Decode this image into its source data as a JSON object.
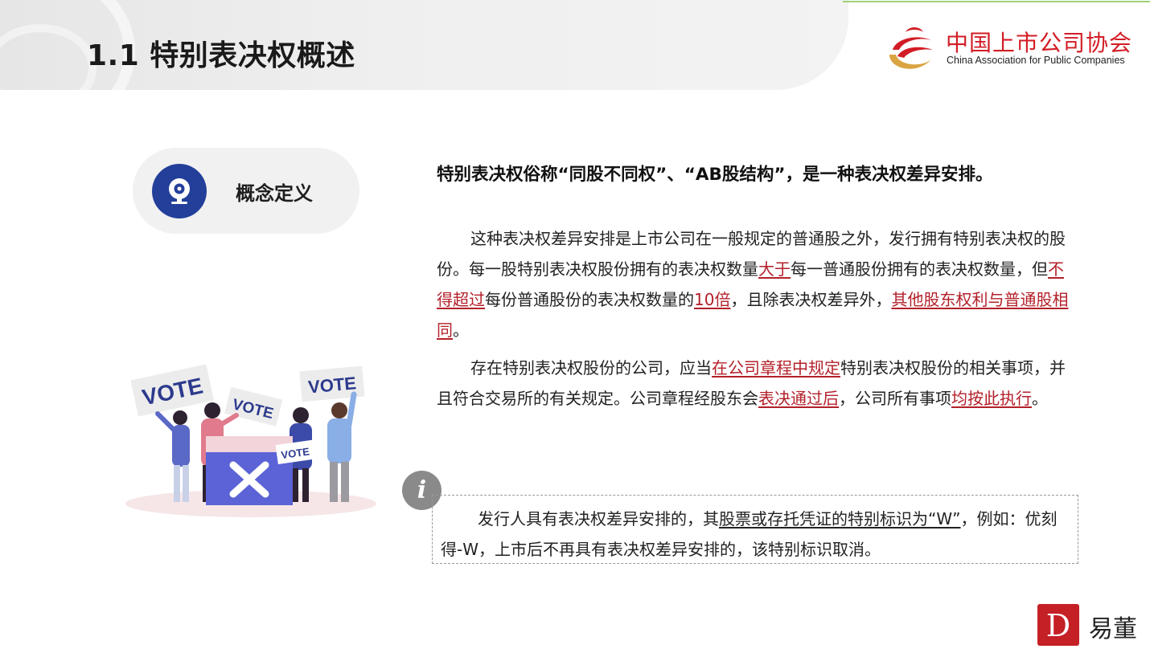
{
  "header": {
    "title": "1.1 特别表决权概述"
  },
  "logo": {
    "name_cn": "中国上市公司协会",
    "name_en": "China Association for Public Companies"
  },
  "concept": {
    "label": "概念定义",
    "icon": "webcam-icon"
  },
  "headline": "特别表决权俗称“同股不同权”、“AB股结构”，是一种表决权差异安排。",
  "paragraph1": {
    "t1": "这种表决权差异安排是上市公司在一般规定的普通股之外，发行拥有特别表决权的股份。每一股特别表决权股份拥有的表决权数量",
    "h1": "大于",
    "t2": "每一普通股份拥有的表决权数量，但",
    "h2": "不得超过",
    "t3": "每份普通股份的表决权数量的",
    "h3": "10倍",
    "t4": "，且除表决权差异外，",
    "h4": "其他股东权利与普通股相同",
    "t5": "。"
  },
  "paragraph2": {
    "t1": "存在特别表决权股份的公司，应当",
    "h1": "在公司章程中规定",
    "t2": "特别表决权股份的相关事项，并且符合交易所的有关规定。公司章程经股东会",
    "h2": "表决通过后",
    "t3": "，公司所有事项",
    "h3": "均按此执行",
    "t4": "。"
  },
  "illustration": {
    "sign_labels": [
      "VOTE",
      "VOTE",
      "VOTE",
      "VOTE"
    ]
  },
  "info": {
    "icon_glyph": "i",
    "t1": "发行人具有表决权差异安排的，其",
    "u1": "股票或存托凭证的特别标识为“W”",
    "t2": "，例如：优刻得-W，上市后不再具有表决权差异安排的，该特别标识取消。"
  },
  "brand": {
    "mark": "D",
    "name": "易董"
  },
  "colors": {
    "accent_red": "#b3202a",
    "logo_red": "#d21d25",
    "navy": "#233f9a",
    "brand_red": "#c52026"
  }
}
